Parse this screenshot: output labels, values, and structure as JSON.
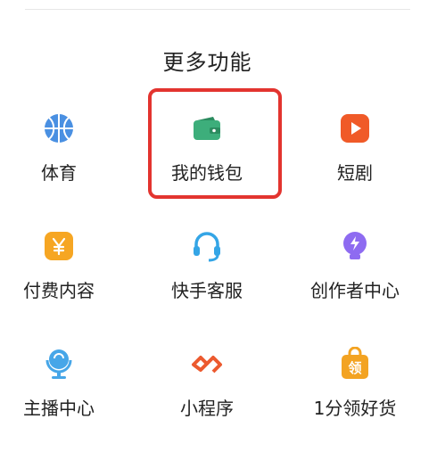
{
  "section": {
    "title": "更多功能"
  },
  "items": [
    {
      "label": "体育",
      "icon": "basketball-icon",
      "color": "#4a90e2"
    },
    {
      "label": "我的钱包",
      "icon": "wallet-icon",
      "color": "#3dae7b"
    },
    {
      "label": "短剧",
      "icon": "play-icon",
      "color": "#f05a28"
    },
    {
      "label": "付费内容",
      "icon": "yen-icon",
      "color": "#f6a623"
    },
    {
      "label": "快手客服",
      "icon": "headset-icon",
      "color": "#34a5e6"
    },
    {
      "label": "创作者中心",
      "icon": "lightning-bulb-icon",
      "color": "#8e6bf1"
    },
    {
      "label": "主播中心",
      "icon": "microphone-icon",
      "color": "#46a6e8"
    },
    {
      "label": "小程序",
      "icon": "link-icon",
      "color": "#ec5a2f"
    },
    {
      "label": "1分领好货",
      "icon": "shopping-bag-icon",
      "color": "#f3a322"
    }
  ],
  "highlight_color": "#e3342f"
}
